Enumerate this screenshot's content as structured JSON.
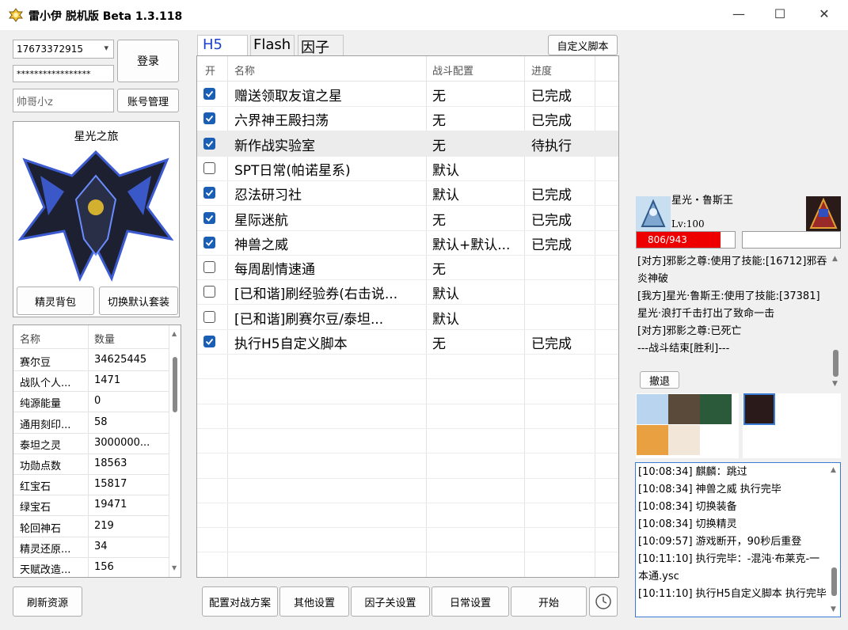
{
  "window": {
    "title": "雷小伊 脱机版 Beta 1.3.118",
    "minimize": "—",
    "maximize": "☐",
    "close": "✕"
  },
  "login": {
    "account": "17673372915",
    "password": "*****************",
    "nickname": "帅哥小z",
    "login_button": "登录",
    "account_mgmt_button": "账号管理"
  },
  "spirit": {
    "name": "星光之旅",
    "bag_button": "精灵背包",
    "switch_button": "切换默认套装"
  },
  "resources": {
    "headers": [
      "名称",
      "数量"
    ],
    "rows": [
      {
        "name": "赛尔豆",
        "value": "34625445"
      },
      {
        "name": "战队个人...",
        "value": "1471"
      },
      {
        "name": "纯源能量",
        "value": "0"
      },
      {
        "name": "通用刻印...",
        "value": "58"
      },
      {
        "name": "泰坦之灵",
        "value": "3000000..."
      },
      {
        "name": "功勋点数",
        "value": "18563"
      },
      {
        "name": "红宝石",
        "value": "15817"
      },
      {
        "name": "绿宝石",
        "value": "19471"
      },
      {
        "name": "轮回神石",
        "value": "219"
      },
      {
        "name": "精灵还原...",
        "value": "34"
      },
      {
        "name": "天赋改造...",
        "value": "156"
      }
    ],
    "refresh_button": "刷新资源"
  },
  "tabs": [
    {
      "label": "H5",
      "active": true
    },
    {
      "label": "Flash",
      "active": false
    },
    {
      "label": "因子",
      "active": false
    }
  ],
  "custom_script_button": "自定义脚本",
  "tasks": {
    "headers": [
      "开",
      "名称",
      "战斗配置",
      "进度"
    ],
    "rows": [
      {
        "on": true,
        "name": "赠送领取友谊之星",
        "config": "无",
        "progress": "已完成"
      },
      {
        "on": true,
        "name": "六界神王殿扫荡",
        "config": "无",
        "progress": "已完成"
      },
      {
        "on": true,
        "name": "新作战实验室",
        "config": "无",
        "progress": "待执行"
      },
      {
        "on": false,
        "name": "SPT日常(帕诺星系)",
        "config": "默认",
        "progress": ""
      },
      {
        "on": true,
        "name": "忍法研习社",
        "config": "默认",
        "progress": "已完成"
      },
      {
        "on": true,
        "name": "星际迷航",
        "config": "无",
        "progress": "已完成"
      },
      {
        "on": true,
        "name": "神兽之威",
        "config": "默认+默认...",
        "progress": "已完成"
      },
      {
        "on": false,
        "name": "每周剧情速通",
        "config": "无",
        "progress": ""
      },
      {
        "on": false,
        "name": "[已和谐]刷经验券(右击说...",
        "config": "默认",
        "progress": ""
      },
      {
        "on": false,
        "name": "[已和谐]刷赛尔豆/泰坦...",
        "config": "默认",
        "progress": ""
      },
      {
        "on": true,
        "name": "执行H5自定义脚本",
        "config": "无",
        "progress": "已完成"
      }
    ]
  },
  "bottom_buttons": {
    "battle_plan": "配置对战方案",
    "other_settings": "其他设置",
    "factor_settings": "因子关设置",
    "daily_settings": "日常设置",
    "start": "开始"
  },
  "battle": {
    "my_name": "星光・鲁斯王",
    "level": "Lv:100",
    "hp_text": "806/943",
    "hp_fraction": 0.855,
    "enemy_hp_fraction": 0.0,
    "log": [
      "[对方]邪影之尊:使用了技能:[16712]邪吞炎神破",
      "[我方]星光·鲁斯王:使用了技能:[37381]星光·浪打千击打出了致命一击",
      "[对方]邪影之尊:已死亡",
      "---战斗结束[胜利]---"
    ],
    "retreat_button": "撤退"
  },
  "run_log": [
    "[10:08:34] 麒麟：跳过",
    "[10:08:34] 神兽之威 执行完毕",
    "[10:08:34] 切换装备",
    "[10:08:34] 切换精灵",
    "[10:09:57] 游戏断开，90秒后重登",
    "[10:11:10] 执行完毕：-混沌·布莱克-一本通.ysc",
    "[10:11:10] 执行H5自定义脚本 执行完毕"
  ],
  "colors": {
    "checkbox": "#1a5fb4",
    "hp_bar": "#ee0000",
    "tab_active_text": "#1a40d0",
    "log_border": "#3a7bd5"
  }
}
